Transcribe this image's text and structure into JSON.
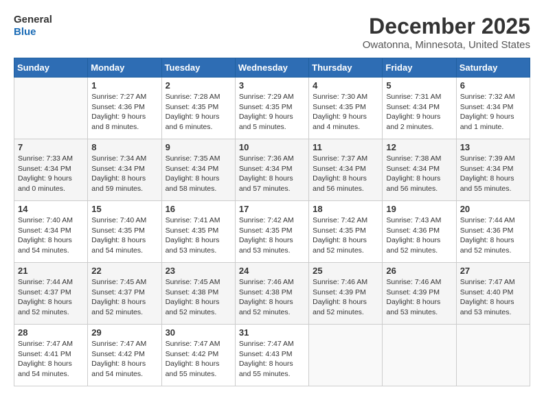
{
  "logo": {
    "line1": "General",
    "line2": "Blue"
  },
  "title": "December 2025",
  "location": "Owatonna, Minnesota, United States",
  "days_header": [
    "Sunday",
    "Monday",
    "Tuesday",
    "Wednesday",
    "Thursday",
    "Friday",
    "Saturday"
  ],
  "weeks": [
    [
      {
        "day": "",
        "info": ""
      },
      {
        "day": "1",
        "info": "Sunrise: 7:27 AM\nSunset: 4:36 PM\nDaylight: 9 hours\nand 8 minutes."
      },
      {
        "day": "2",
        "info": "Sunrise: 7:28 AM\nSunset: 4:35 PM\nDaylight: 9 hours\nand 6 minutes."
      },
      {
        "day": "3",
        "info": "Sunrise: 7:29 AM\nSunset: 4:35 PM\nDaylight: 9 hours\nand 5 minutes."
      },
      {
        "day": "4",
        "info": "Sunrise: 7:30 AM\nSunset: 4:35 PM\nDaylight: 9 hours\nand 4 minutes."
      },
      {
        "day": "5",
        "info": "Sunrise: 7:31 AM\nSunset: 4:34 PM\nDaylight: 9 hours\nand 2 minutes."
      },
      {
        "day": "6",
        "info": "Sunrise: 7:32 AM\nSunset: 4:34 PM\nDaylight: 9 hours\nand 1 minute."
      }
    ],
    [
      {
        "day": "7",
        "info": "Sunrise: 7:33 AM\nSunset: 4:34 PM\nDaylight: 9 hours\nand 0 minutes."
      },
      {
        "day": "8",
        "info": "Sunrise: 7:34 AM\nSunset: 4:34 PM\nDaylight: 8 hours\nand 59 minutes."
      },
      {
        "day": "9",
        "info": "Sunrise: 7:35 AM\nSunset: 4:34 PM\nDaylight: 8 hours\nand 58 minutes."
      },
      {
        "day": "10",
        "info": "Sunrise: 7:36 AM\nSunset: 4:34 PM\nDaylight: 8 hours\nand 57 minutes."
      },
      {
        "day": "11",
        "info": "Sunrise: 7:37 AM\nSunset: 4:34 PM\nDaylight: 8 hours\nand 56 minutes."
      },
      {
        "day": "12",
        "info": "Sunrise: 7:38 AM\nSunset: 4:34 PM\nDaylight: 8 hours\nand 56 minutes."
      },
      {
        "day": "13",
        "info": "Sunrise: 7:39 AM\nSunset: 4:34 PM\nDaylight: 8 hours\nand 55 minutes."
      }
    ],
    [
      {
        "day": "14",
        "info": "Sunrise: 7:40 AM\nSunset: 4:34 PM\nDaylight: 8 hours\nand 54 minutes."
      },
      {
        "day": "15",
        "info": "Sunrise: 7:40 AM\nSunset: 4:35 PM\nDaylight: 8 hours\nand 54 minutes."
      },
      {
        "day": "16",
        "info": "Sunrise: 7:41 AM\nSunset: 4:35 PM\nDaylight: 8 hours\nand 53 minutes."
      },
      {
        "day": "17",
        "info": "Sunrise: 7:42 AM\nSunset: 4:35 PM\nDaylight: 8 hours\nand 53 minutes."
      },
      {
        "day": "18",
        "info": "Sunrise: 7:42 AM\nSunset: 4:35 PM\nDaylight: 8 hours\nand 52 minutes."
      },
      {
        "day": "19",
        "info": "Sunrise: 7:43 AM\nSunset: 4:36 PM\nDaylight: 8 hours\nand 52 minutes."
      },
      {
        "day": "20",
        "info": "Sunrise: 7:44 AM\nSunset: 4:36 PM\nDaylight: 8 hours\nand 52 minutes."
      }
    ],
    [
      {
        "day": "21",
        "info": "Sunrise: 7:44 AM\nSunset: 4:37 PM\nDaylight: 8 hours\nand 52 minutes."
      },
      {
        "day": "22",
        "info": "Sunrise: 7:45 AM\nSunset: 4:37 PM\nDaylight: 8 hours\nand 52 minutes."
      },
      {
        "day": "23",
        "info": "Sunrise: 7:45 AM\nSunset: 4:38 PM\nDaylight: 8 hours\nand 52 minutes."
      },
      {
        "day": "24",
        "info": "Sunrise: 7:46 AM\nSunset: 4:38 PM\nDaylight: 8 hours\nand 52 minutes."
      },
      {
        "day": "25",
        "info": "Sunrise: 7:46 AM\nSunset: 4:39 PM\nDaylight: 8 hours\nand 52 minutes."
      },
      {
        "day": "26",
        "info": "Sunrise: 7:46 AM\nSunset: 4:39 PM\nDaylight: 8 hours\nand 53 minutes."
      },
      {
        "day": "27",
        "info": "Sunrise: 7:47 AM\nSunset: 4:40 PM\nDaylight: 8 hours\nand 53 minutes."
      }
    ],
    [
      {
        "day": "28",
        "info": "Sunrise: 7:47 AM\nSunset: 4:41 PM\nDaylight: 8 hours\nand 54 minutes."
      },
      {
        "day": "29",
        "info": "Sunrise: 7:47 AM\nSunset: 4:42 PM\nDaylight: 8 hours\nand 54 minutes."
      },
      {
        "day": "30",
        "info": "Sunrise: 7:47 AM\nSunset: 4:42 PM\nDaylight: 8 hours\nand 55 minutes."
      },
      {
        "day": "31",
        "info": "Sunrise: 7:47 AM\nSunset: 4:43 PM\nDaylight: 8 hours\nand 55 minutes."
      },
      {
        "day": "",
        "info": ""
      },
      {
        "day": "",
        "info": ""
      },
      {
        "day": "",
        "info": ""
      }
    ]
  ]
}
